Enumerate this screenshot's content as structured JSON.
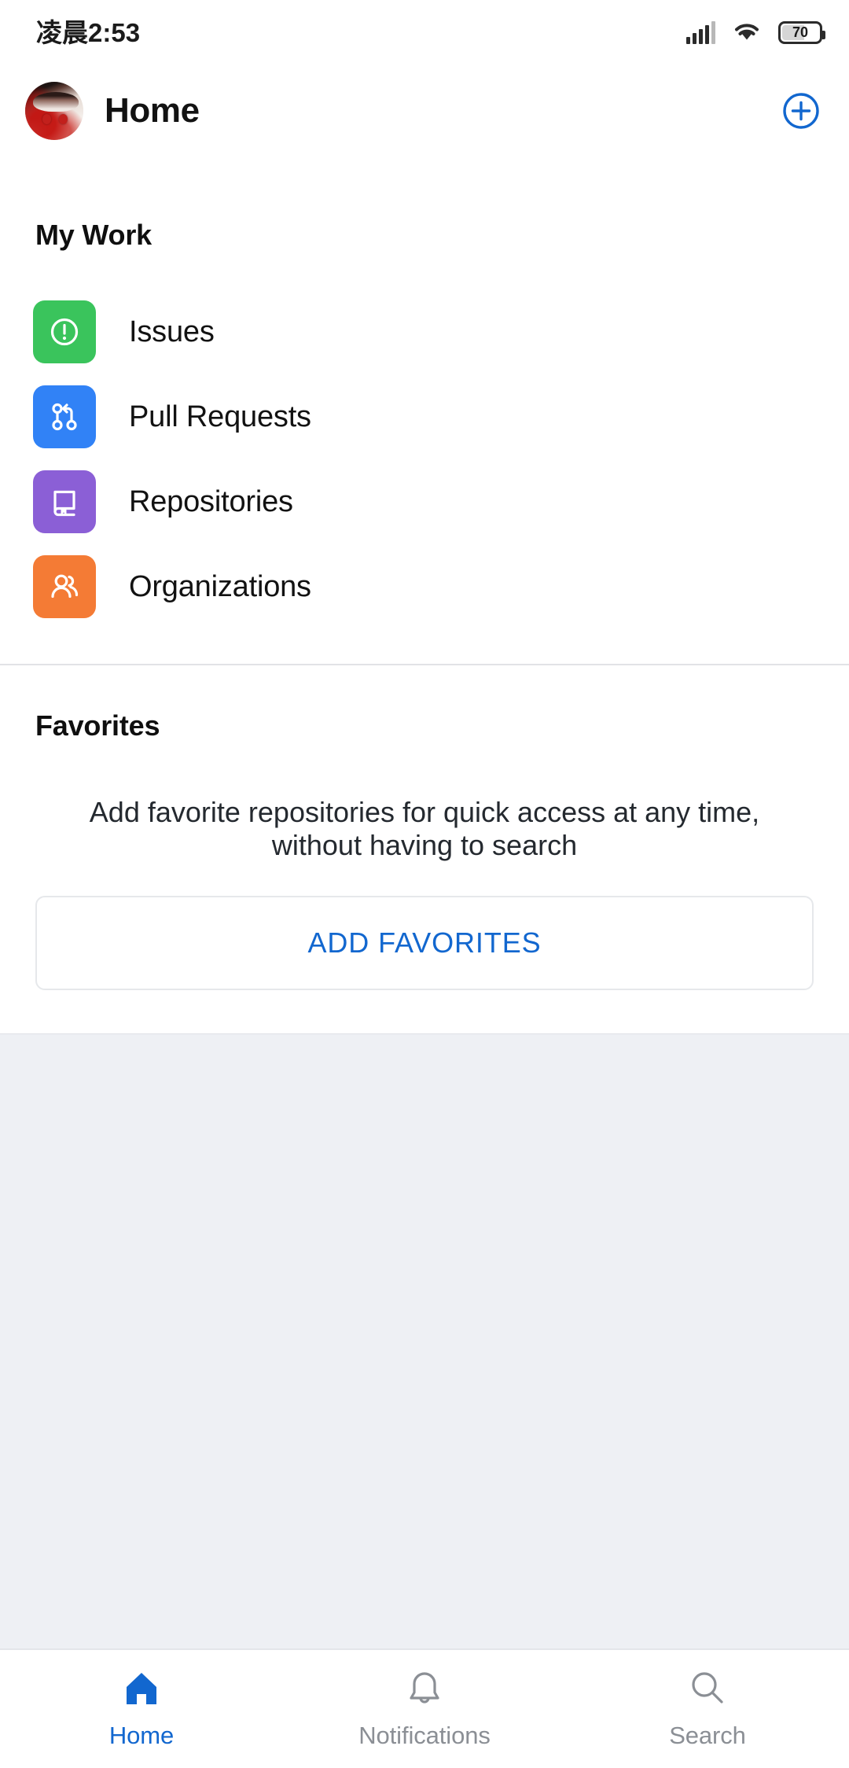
{
  "status_bar": {
    "time": "凌晨2:53",
    "signal_icon": "signal-bars-icon",
    "wifi_icon": "wifi-icon",
    "battery_icon": "battery-icon",
    "battery_level": "70"
  },
  "header": {
    "avatar": "user-avatar",
    "title": "Home",
    "add_icon": "plus-circle-icon"
  },
  "my_work": {
    "title": "My Work",
    "items": [
      {
        "label": "Issues",
        "icon": "issue-opened-icon",
        "color": "#3ac45c"
      },
      {
        "label": "Pull Requests",
        "icon": "git-pull-request-icon",
        "color": "#3182f6"
      },
      {
        "label": "Repositories",
        "icon": "repo-icon",
        "color": "#8b5fd6"
      },
      {
        "label": "Organizations",
        "icon": "organization-icon",
        "color": "#f47b35"
      }
    ]
  },
  "favorites": {
    "title": "Favorites",
    "empty_text": "Add favorite repositories for quick access at any time, without having to search",
    "button_label": "ADD FAVORITES"
  },
  "bottom_nav": {
    "items": [
      {
        "label": "Home",
        "icon": "home-icon",
        "active": true
      },
      {
        "label": "Notifications",
        "icon": "bell-icon",
        "active": false
      },
      {
        "label": "Search",
        "icon": "search-icon",
        "active": false
      }
    ]
  },
  "colors": {
    "accent_blue": "#1267cf",
    "text_primary": "#121212",
    "text_muted": "#8b8f95",
    "page_bg": "#eef0f4",
    "divider": "#e2e3e6"
  }
}
